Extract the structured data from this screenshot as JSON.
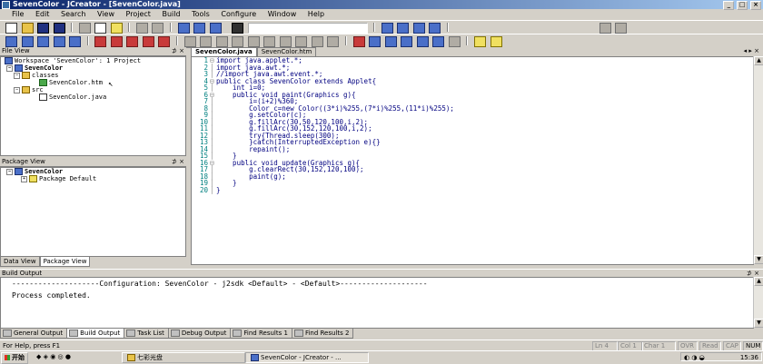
{
  "window": {
    "title": "SevenColor - JCreator - [SevenColor.java]"
  },
  "menu": [
    "File",
    "Edit",
    "Search",
    "View",
    "Project",
    "Build",
    "Tools",
    "Configure",
    "Window",
    "Help"
  ],
  "file_view": {
    "title": "File View",
    "tree": [
      {
        "label": "Workspace 'SevenColor': 1 Project",
        "indent": 0
      },
      {
        "label": "SevenColor",
        "indent": 1,
        "bold": true
      },
      {
        "label": "classes",
        "indent": 2
      },
      {
        "label": "SevenColor.htm",
        "indent": 3
      },
      {
        "label": "src",
        "indent": 2
      },
      {
        "label": "SevenColor.java",
        "indent": 3
      }
    ],
    "tabs": [
      "Data View",
      "Package View"
    ]
  },
  "package_view": {
    "title": "Package View",
    "tree": [
      {
        "label": "SevenColor",
        "indent": 0,
        "bold": true
      },
      {
        "label": "Package Default",
        "indent": 1
      }
    ]
  },
  "editor": {
    "tabs": [
      "SevenColor.java",
      "SevenColor.htm"
    ],
    "lines": [
      {
        "n": "1",
        "text": "import java.applet.*;"
      },
      {
        "n": "2",
        "text": "import java.awt.*;"
      },
      {
        "n": "3",
        "text": "//import java.awt.event.*;"
      },
      {
        "n": "4",
        "text": "public class SevenColor extends Applet{"
      },
      {
        "n": "5",
        "text": "    int i=0;"
      },
      {
        "n": "6",
        "text": "    public void paint(Graphics g){"
      },
      {
        "n": "7",
        "text": "        i=(i+2)%360;"
      },
      {
        "n": "8",
        "text": "        Color c=new Color((3*i)%255,(7*i)%255,(11*i)%255);"
      },
      {
        "n": "9",
        "text": "        g.setColor(c);"
      },
      {
        "n": "10",
        "text": "        g.fillArc(30,50,120,100,i,2);"
      },
      {
        "n": "11",
        "text": "        g.fillArc(30,152,120,100,i,2);"
      },
      {
        "n": "12",
        "text": "        try{Thread.sleep(300);"
      },
      {
        "n": "13",
        "text": "        }catch(InterruptedException e){}"
      },
      {
        "n": "14",
        "text": "        repaint();"
      },
      {
        "n": "15",
        "text": "    }"
      },
      {
        "n": "16",
        "text": "    public void update(Graphics g){"
      },
      {
        "n": "17",
        "text": "        g.clearRect(30,152,120,100);"
      },
      {
        "n": "18",
        "text": "        paint(g);"
      },
      {
        "n": "19",
        "text": "    }"
      },
      {
        "n": "20",
        "text": "}"
      }
    ]
  },
  "build_output": {
    "title": "Build Output",
    "lines": [
      "--------------------Configuration: SevenColor - j2sdk <Default> - <Default>--------------------",
      "Process completed."
    ],
    "tabs": [
      "General Output",
      "Build Output",
      "Task List",
      "Debug Output",
      "Find Results 1",
      "Find Results 2"
    ]
  },
  "status": {
    "help": "For Help, press F1",
    "ln": "Ln 4",
    "col": "Col 1",
    "char": "Char 1",
    "ovr": "OVR",
    "read": "Read",
    "cap": "CAP",
    "num": "NUM"
  },
  "taskbar": {
    "start": "开始",
    "tasks": [
      "七彩光盘",
      "SevenColor - JCreator - ..."
    ],
    "clock": "15:36"
  },
  "colors": {
    "keyword": "#0000ff",
    "code": "#000080",
    "line_number": "#008080",
    "title_bar": "#0a246a"
  }
}
